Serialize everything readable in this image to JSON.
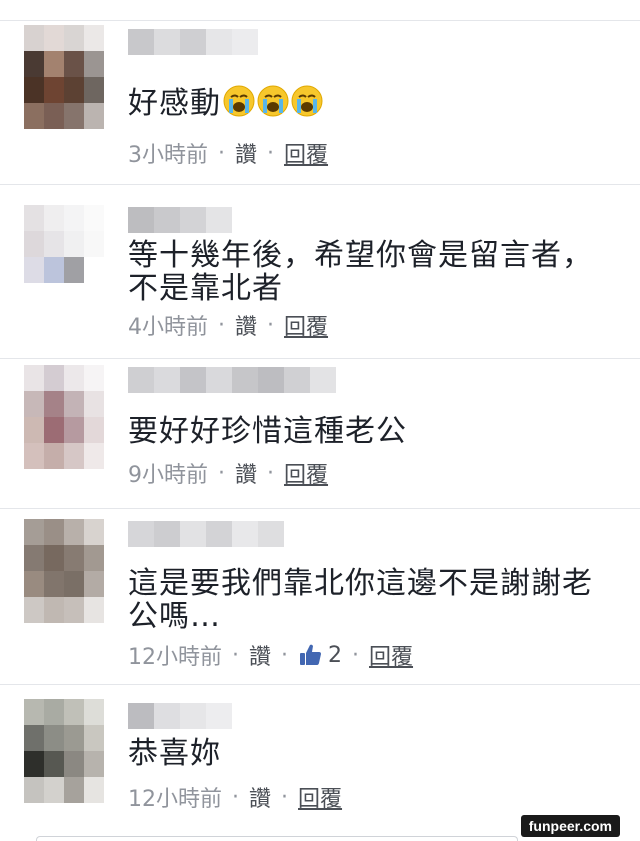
{
  "comments": [
    {
      "text_lines": [
        "好感動"
      ],
      "emojis": [
        "crying-face-icon",
        "crying-face-icon",
        "crying-face-icon"
      ],
      "time": "3小時前",
      "like_label": "讚",
      "reply_label": "回覆"
    },
    {
      "text_lines": [
        "等十幾年後，希望你會是留言者，",
        "不是靠北者"
      ],
      "time": "4小時前",
      "like_label": "讚",
      "reply_label": "回覆"
    },
    {
      "text_lines": [
        "要好好珍惜這種老公"
      ],
      "time": "9小時前",
      "like_label": "讚",
      "reply_label": "回覆"
    },
    {
      "text_lines": [
        "這是要我們靠北你這邊不是謝謝老",
        "公嗎…"
      ],
      "time": "12小時前",
      "like_label": "讚",
      "like_count": "2",
      "reply_label": "回覆"
    },
    {
      "text_lines": [
        "恭喜妳"
      ],
      "time": "12小時前",
      "like_label": "讚",
      "reply_label": "回覆"
    }
  ],
  "separator": "·",
  "watermark": "funpeer.com",
  "colors": {
    "text": "#1d2129",
    "meta": "#90949c",
    "link": "#4b4f56",
    "like_blue": "#4267b2",
    "divider": "#e4e6ea"
  }
}
